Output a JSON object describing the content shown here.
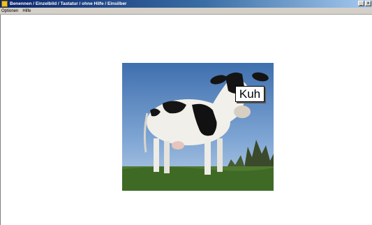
{
  "window": {
    "title": "Benennen / Einzelbild / Tastatur / ohne Hilfe / Einsilber",
    "minimize_glyph": "_",
    "close_glyph": "x"
  },
  "menu": {
    "items": [
      {
        "label": "Optionen"
      },
      {
        "label": "Hilfe"
      }
    ]
  },
  "picture": {
    "subject_icon": "cow-photo",
    "label": "Kuh"
  }
}
